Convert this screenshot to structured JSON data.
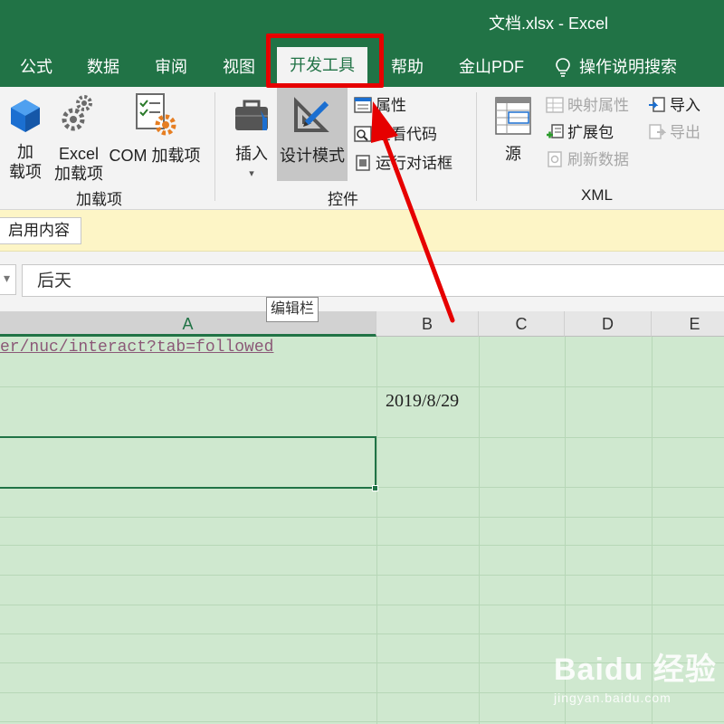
{
  "window": {
    "title": "文档.xlsx  -  Excel"
  },
  "tabs": [
    {
      "label": "公式"
    },
    {
      "label": "数据"
    },
    {
      "label": "审阅"
    },
    {
      "label": "视图"
    },
    {
      "label": "开发工具",
      "active": true
    },
    {
      "label": "帮助"
    },
    {
      "label": "金山PDF"
    },
    {
      "label": "操作说明搜索",
      "icon": "lightbulb-icon"
    }
  ],
  "ribbon": {
    "addins": {
      "group_label": "加载项",
      "addins_btn": {
        "line1": "加",
        "line2": "载项"
      },
      "excel_addins_btn": {
        "line1": "Excel",
        "line2": "加载项"
      },
      "com_addins_btn": {
        "label": "COM 加载项"
      }
    },
    "controls": {
      "group_label": "控件",
      "insert_btn": {
        "label": "插入",
        "caret": "▾"
      },
      "design_mode_btn": {
        "label": "设计模式"
      },
      "properties": {
        "label": "属性"
      },
      "view_code": {
        "label": "查看代码"
      },
      "run_dialog": {
        "label": "运行对话框"
      }
    },
    "xml": {
      "group_label": "XML",
      "source_btn": {
        "label": "源"
      },
      "map_properties": {
        "label": "映射属性"
      },
      "expansion_packs": {
        "label": "扩展包"
      },
      "refresh_data": {
        "label": "刷新数据"
      },
      "import": {
        "label": "导入"
      },
      "export": {
        "label": "导出"
      }
    }
  },
  "message_bar": {
    "button_label": "启用内容"
  },
  "formula_bar": {
    "value": "后天",
    "tooltip": "编辑栏",
    "namebox_arrow": "▾"
  },
  "columns": [
    {
      "label": "A"
    },
    {
      "label": "B"
    },
    {
      "label": "C"
    },
    {
      "label": "D"
    },
    {
      "label": "E"
    }
  ],
  "cells": {
    "a1": "er/nuc/interact?tab=followed",
    "b2": "2019/8/29"
  },
  "watermark": {
    "brand": "Baidu 经验",
    "url": "jingyan.baidu.com"
  },
  "colors": {
    "excel_green": "#217346",
    "annotation_red": "#e60000",
    "grid_fill": "#cfe8cf",
    "message_bar": "#fdf5c6"
  }
}
